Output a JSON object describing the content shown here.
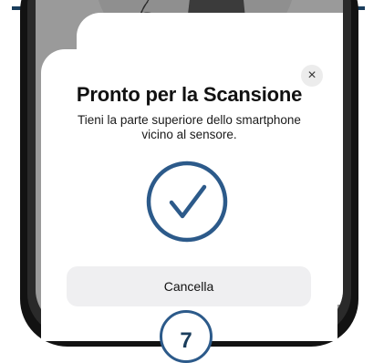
{
  "sheet": {
    "title": "Pronto per la Scansione",
    "description_line1": "Tieni la parte superiore dello smartphone",
    "description_line2": "vicino al sensore.",
    "status_icon": "check-circle-icon",
    "close_icon": "close-icon",
    "close_glyph": "×",
    "cancel_label": "Cancella"
  },
  "step": {
    "number": "7"
  },
  "colors": {
    "accent": "#2c5a8a",
    "header_rule": "#1a3d5c",
    "sheet_bg": "#ffffff",
    "button_bg": "#efeff1",
    "phone_frame": "#121212"
  }
}
